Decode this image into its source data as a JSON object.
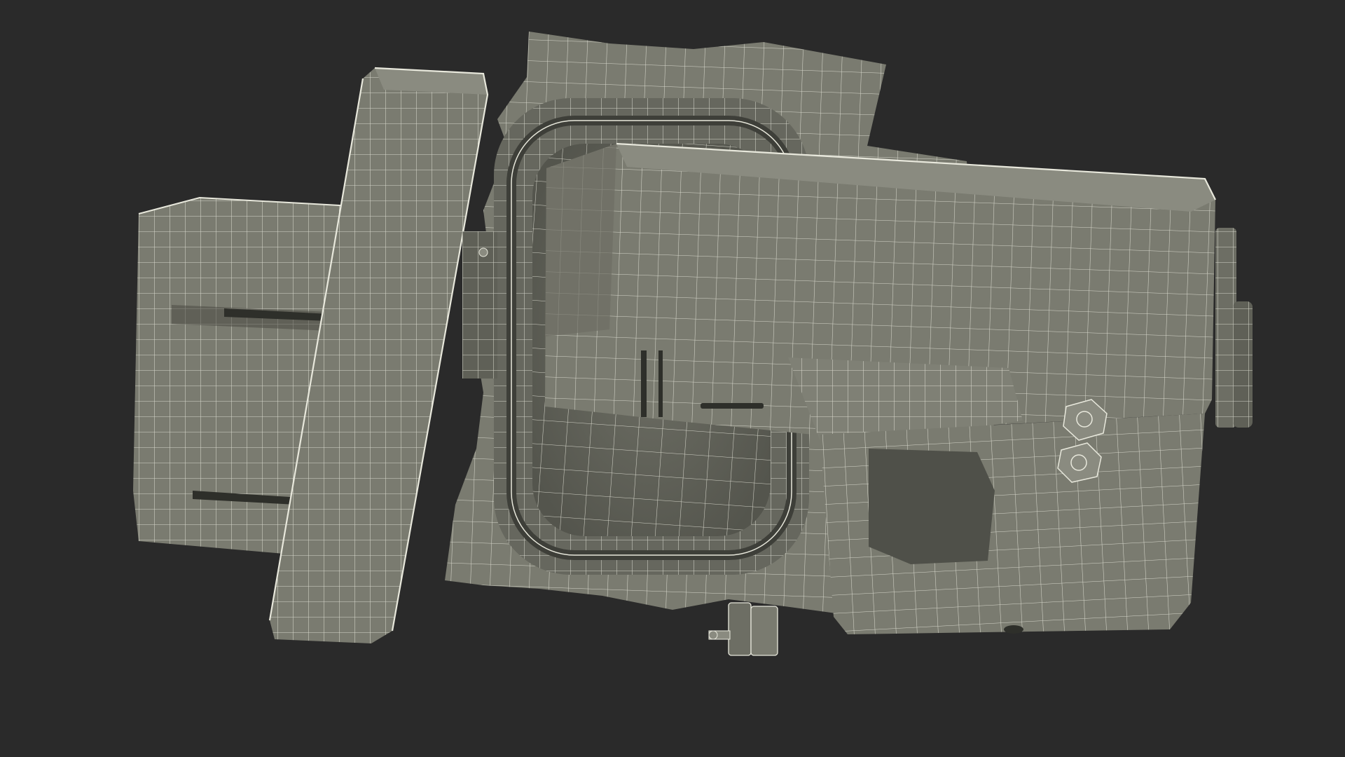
{
  "scene": {
    "kind": "3d-wireframe-render",
    "subject": "",
    "colors": {
      "background": "#2a2a2a",
      "surface": "#7a7b70",
      "surface_dark": "#5f6057",
      "surface_shadow": "#4a4b44",
      "wire": "#e8e8dc"
    }
  }
}
